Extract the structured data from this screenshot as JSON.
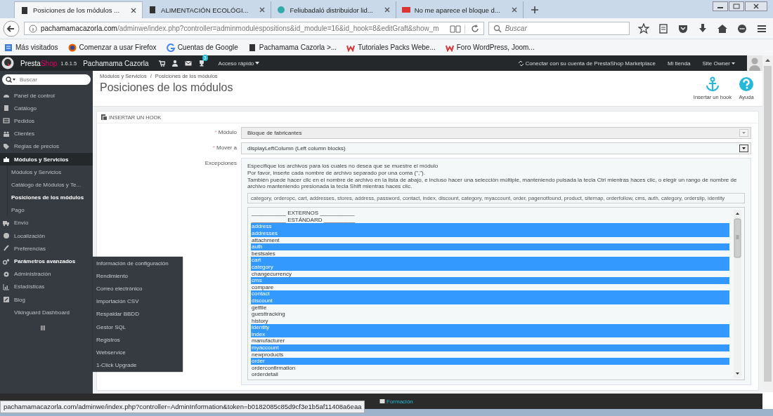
{
  "browser": {
    "tabs": [
      {
        "label": "Posiciones de los módulos ...",
        "selected": true
      },
      {
        "label": "ALIMENTACIÓN ECOLÓGI...",
        "selected": false
      },
      {
        "label": "Feliubadaló distribuidor lid...",
        "selected": false
      },
      {
        "label": "No me aparece el bloque d...",
        "selected": false
      }
    ],
    "url_host": "pachamamacazorla.com",
    "url_path": "/adminwe/index.php?controller=adminmodulespositions&id_module=16&id_hook=8&editGraft&show_m",
    "search": {
      "placeholder": "Buscar"
    },
    "bookmarks": [
      "Más visitados",
      "Comenzar a usar Firefox",
      "Cuentas de Google",
      "Pachamama Cazorla >...",
      "Tutoriales Packs Webe...",
      "Foro WordPress, Joom..."
    ],
    "status_url": "pachamamacazorla.com/adminwe/index.php?controller=AdminInformation&token=b0182085c85d9cf3e1b5af11408a6eaa"
  },
  "header": {
    "brand_first": "Presta",
    "brand_second": "Shop",
    "version": "1.6.1.5",
    "shop": "Pachamama Cazorla",
    "notification_count": "3",
    "quick_access": "Acceso rápido",
    "marketplace": "Conectar con su cuenta de PrestaShop Marketplace",
    "my_shop": "Mi tienda",
    "user": "Site Owner"
  },
  "sidebar": {
    "search": {
      "placeholder": "Buscar"
    },
    "items": [
      {
        "label": "Panel de control",
        "selected": false,
        "hovered": false
      },
      {
        "label": "Catálogo",
        "selected": false,
        "hovered": false
      },
      {
        "label": "Pedidos",
        "selected": false,
        "hovered": false
      },
      {
        "label": "Clientes",
        "selected": false,
        "hovered": false
      },
      {
        "label": "Reglas de precios",
        "selected": false,
        "hovered": false
      },
      {
        "label": "Módulos y Servicios",
        "selected": true,
        "hovered": false,
        "children": [
          {
            "label": "Módulos y Servicios",
            "selected": false
          },
          {
            "label": "Catálogo de Módulos y Te...",
            "selected": false
          },
          {
            "label": "Posiciones de los módulos",
            "selected": true
          },
          {
            "label": "Pago",
            "selected": false
          }
        ]
      },
      {
        "label": "Envío",
        "selected": false,
        "hovered": false
      },
      {
        "label": "Localización",
        "selected": false,
        "hovered": false
      },
      {
        "label": "Preferencias",
        "selected": false,
        "hovered": false
      },
      {
        "label": "Parámetros avanzados",
        "selected": false,
        "hovered": true
      },
      {
        "label": "Administración",
        "selected": false,
        "hovered": false
      },
      {
        "label": "Estadísticas",
        "selected": false,
        "hovered": false
      },
      {
        "label": "Blog",
        "selected": false,
        "hovered": false
      },
      {
        "label": "Vikinguard Dashboard",
        "selected": false,
        "hovered": false
      }
    ],
    "flyout": [
      "Información de configuración",
      "Rendimiento",
      "Correo electrónico",
      "Importación CSV",
      "Respaldar BBDD",
      "Gestor SQL",
      "Registros",
      "Webservice",
      "1-Click Upgrade"
    ]
  },
  "page": {
    "breadcrumb": [
      "Módulos y Servicios",
      "/",
      "Posiciones de los módulos"
    ],
    "title": "Posiciones de los módulos",
    "toolbar": [
      "Insertar un hook",
      "Ayuda"
    ]
  },
  "panel": {
    "heading": "INSERTAR UN HOOK",
    "fields": [
      {
        "kind": "select",
        "required_mark": "*",
        "label": "Módulo",
        "value": "Bloque de fabricantes",
        "disabled": true
      },
      {
        "kind": "select",
        "required_mark": "*",
        "label": "Mover a",
        "value": "displayLeftColumn (Left column blocks)",
        "disabled": false
      },
      {
        "kind": "exceptions",
        "label": "Excepciones",
        "help": [
          "Especifique los archivos para los cuales no desea que se muestre el módulo",
          "Por favor, inserte cada nombre de archivo separado por una coma (\",\").",
          "También puede hacer clic en el nombre de archivo en la lista de abajo, e incluso hacer una selección múltiple, manteniendo pulsada la tecla Ctrl mientras haces clic, o elegir un rango de nombre de archivo manteniendo presionada la tecla Shift mientras haces clic."
        ],
        "value": "category, orderopc, cart, addresses, stores, address, password, contact, index, discount, category, myaccount, order, pagenotfound, product, sitemap, orderfollow, cms, auth, category, orderslip, identity",
        "options": [
          {
            "label": "___________ EXTERNOS ___________",
            "selected": false
          },
          {
            "label": "___________ ESTÁNDARD __________",
            "selected": false
          },
          {
            "label": "address",
            "selected": true
          },
          {
            "label": "addresses",
            "selected": true
          },
          {
            "label": "attachment",
            "selected": false
          },
          {
            "label": "auth",
            "selected": true
          },
          {
            "label": "bestsales",
            "selected": false
          },
          {
            "label": "cart",
            "selected": true
          },
          {
            "label": "category",
            "selected": true
          },
          {
            "label": "changecurrency",
            "selected": false
          },
          {
            "label": "cms",
            "selected": true
          },
          {
            "label": "compare",
            "selected": false
          },
          {
            "label": "contact",
            "selected": true
          },
          {
            "label": "discount",
            "selected": true
          },
          {
            "label": "getfile",
            "selected": false
          },
          {
            "label": "guesttracking",
            "selected": false
          },
          {
            "label": "history",
            "selected": false
          },
          {
            "label": "identity",
            "selected": true
          },
          {
            "label": "index",
            "selected": true
          },
          {
            "label": "manufacturer",
            "selected": false
          },
          {
            "label": "myaccount",
            "selected": true
          },
          {
            "label": "newproducts",
            "selected": false
          },
          {
            "label": "order",
            "selected": true
          },
          {
            "label": "orderconfirmation",
            "selected": false
          },
          {
            "label": "orderdetail",
            "selected": false
          }
        ]
      }
    ]
  },
  "footer": {
    "link": "Formación"
  }
}
